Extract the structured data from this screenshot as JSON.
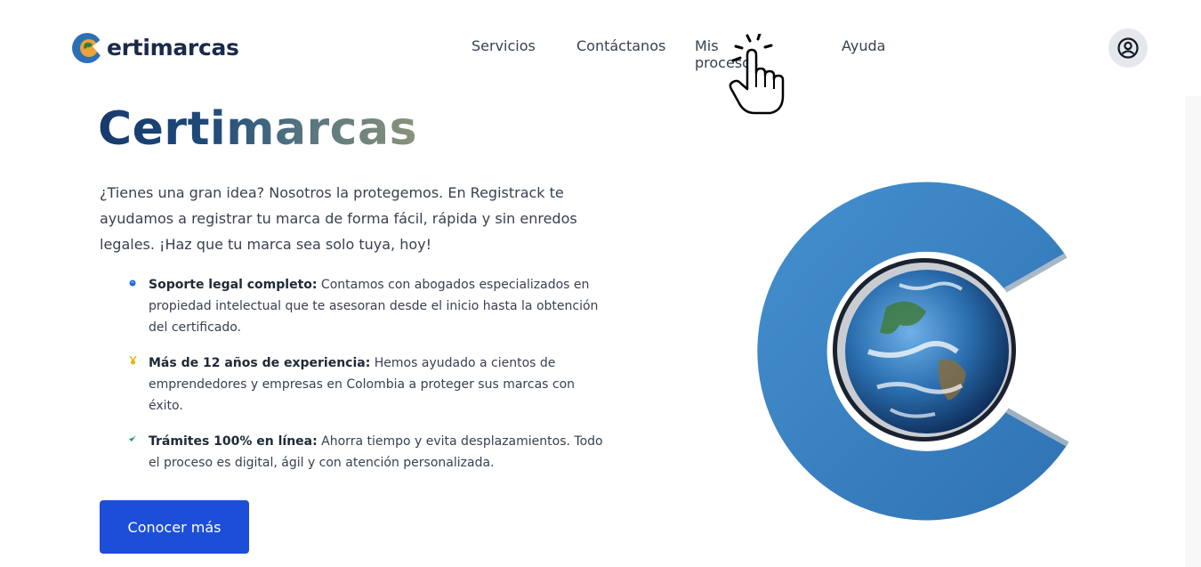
{
  "header": {
    "logo_text": "ertimarcas",
    "nav": [
      {
        "label": "Servicios"
      },
      {
        "label": "Contáctanos"
      },
      {
        "label": "Mis procesos"
      },
      {
        "label": "Ayuda"
      }
    ],
    "user_icon": "user-circle-icon"
  },
  "hero": {
    "title": "Certimarcas",
    "description": "¿Tienes una gran idea? Nosotros la protegemos. En Registrack te ayudamos a registrar tu marca de forma fácil, rápida y sin enredos legales. ¡Haz que tu marca sea solo tuya, hoy!",
    "features": [
      {
        "icon": "globe-icon",
        "title": "Soporte legal completo:",
        "text": " Contamos con abogados especializados en propiedad intelectual que te asesoran desde el inicio hasta la obtención del certificado.",
        "color": "#2563eb"
      },
      {
        "icon": "medal-icon",
        "title": "Más de 12 años de experiencia:",
        "text": " Hemos ayudado a cientos de emprendedores y empresas en Colombia a proteger sus marcas con éxito.",
        "color": "#eab308"
      },
      {
        "icon": "check-icon",
        "title": "Trámites 100% en línea:",
        "text": " Ahorra tiempo y evita desplazamientos. Todo el proceso es digital, ágil y con atención personalizada.",
        "color": "#16a34a"
      }
    ],
    "cta_label": "Conocer más"
  },
  "colors": {
    "primary": "#1d4ed8",
    "title_dark": "#173a6e",
    "brand_blue": "#3a7fc0"
  }
}
